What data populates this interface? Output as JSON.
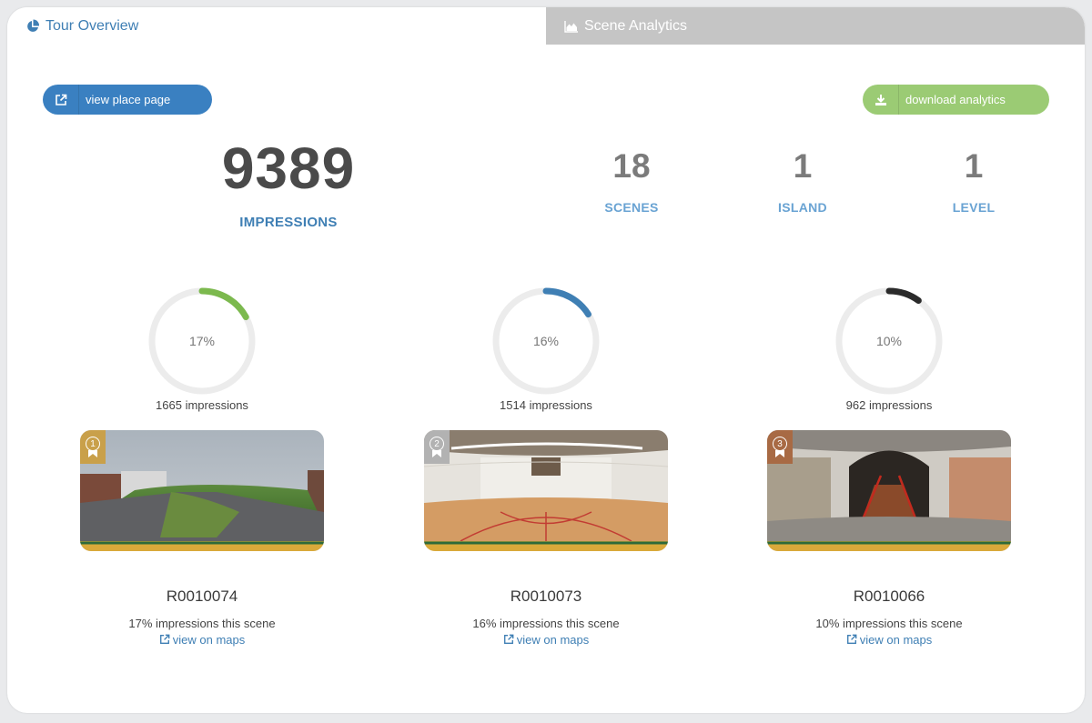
{
  "tabs": [
    {
      "label": "Tour Overview",
      "icon": "pie-chart-icon",
      "active": true
    },
    {
      "label": "Scene Analytics",
      "icon": "area-chart-icon",
      "active": false
    }
  ],
  "buttons": {
    "view_place": {
      "label": "view place page",
      "icon": "external-link-icon",
      "color": "#3a80c1"
    },
    "download": {
      "label": "download analytics",
      "icon": "download-icon",
      "color": "#9bcb74"
    }
  },
  "summary": {
    "impressions": {
      "value": "9389",
      "label": "IMPRESSIONS"
    },
    "scenes": {
      "value": "18",
      "label": "SCENES"
    },
    "island": {
      "value": "1",
      "label": "ISLAND"
    },
    "level": {
      "value": "1",
      "label": "LEVEL"
    }
  },
  "scenes": [
    {
      "rank": "1",
      "percent": 17,
      "percent_label": "17%",
      "impressions_label": "1665 impressions",
      "id": "R0010074",
      "desc": "17% impressions this scene",
      "maps_label": "view on maps",
      "ring_color": "#7cb94e",
      "badge_color": "#c9a04a"
    },
    {
      "rank": "2",
      "percent": 16,
      "percent_label": "16%",
      "impressions_label": "1514 impressions",
      "id": "R0010073",
      "desc": "16% impressions this scene",
      "maps_label": "view on maps",
      "ring_color": "#3f7fb4",
      "badge_color": "#b2b2b2"
    },
    {
      "rank": "3",
      "percent": 10,
      "percent_label": "10%",
      "impressions_label": "962 impressions",
      "id": "R0010066",
      "desc": "10% impressions this scene",
      "maps_label": "view on maps",
      "ring_color": "#2b2b2b",
      "badge_color": "#a86a44"
    }
  ]
}
